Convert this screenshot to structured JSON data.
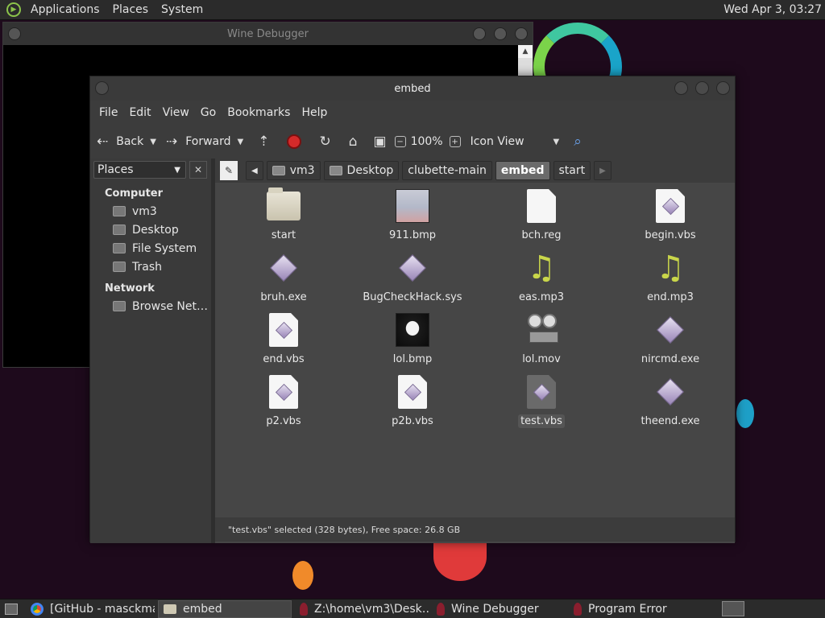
{
  "top_panel": {
    "menus": [
      "Applications",
      "Places",
      "System"
    ],
    "clock": "Wed Apr  3, 03:27"
  },
  "wine_window": {
    "title": "Wine Debugger"
  },
  "file_manager": {
    "title": "embed",
    "menubar": [
      "File",
      "Edit",
      "View",
      "Go",
      "Bookmarks",
      "Help"
    ],
    "toolbar": {
      "back_label": "Back",
      "forward_label": "Forward",
      "zoom": "100%",
      "view_mode": "Icon View"
    },
    "sidebar": {
      "selector": "Places",
      "sections": [
        {
          "title": "Computer",
          "items": [
            "vm3",
            "Desktop",
            "File System",
            "Trash"
          ]
        },
        {
          "title": "Network",
          "items": [
            "Browse Net…"
          ]
        }
      ]
    },
    "pathbar": [
      "vm3",
      "Desktop",
      "clubette-main",
      "embed",
      "start"
    ],
    "files": [
      {
        "name": "start",
        "icon": "folder-icon"
      },
      {
        "name": "911.bmp",
        "icon": "image-thumbnail"
      },
      {
        "name": "bch.reg",
        "icon": "document-icon"
      },
      {
        "name": "begin.vbs",
        "icon": "script-icon"
      },
      {
        "name": "bruh.exe",
        "icon": "executable-icon"
      },
      {
        "name": "BugCheckHack.sys",
        "icon": "executable-icon"
      },
      {
        "name": "eas.mp3",
        "icon": "music-note-icon"
      },
      {
        "name": "end.mp3",
        "icon": "music-note-icon"
      },
      {
        "name": "end.vbs",
        "icon": "script-icon"
      },
      {
        "name": "lol.bmp",
        "icon": "image-thumbnail"
      },
      {
        "name": "lol.mov",
        "icon": "film-reel-icon"
      },
      {
        "name": "nircmd.exe",
        "icon": "executable-icon"
      },
      {
        "name": "p2.vbs",
        "icon": "script-icon"
      },
      {
        "name": "p2b.vbs",
        "icon": "script-icon"
      },
      {
        "name": "test.vbs",
        "icon": "script-icon",
        "selected": true
      },
      {
        "name": "theend.exe",
        "icon": "executable-icon"
      }
    ],
    "status": "\"test.vbs\" selected (328 bytes), Free space: 26.8 GB"
  },
  "taskbar": [
    {
      "label": "[GitHub - masckma…",
      "icon": "chrome-icon"
    },
    {
      "label": "embed",
      "icon": "folder-icon",
      "active": true
    },
    {
      "label": "Z:\\home\\vm3\\Desk…",
      "icon": "wine-icon"
    },
    {
      "label": "Wine Debugger",
      "icon": "wine-icon"
    },
    {
      "label": "Program Error",
      "icon": "wine-icon"
    }
  ],
  "colors": {
    "accent_selection": "#555555",
    "stop_red": "#d42a2a",
    "music_note": "#c9d64a"
  }
}
